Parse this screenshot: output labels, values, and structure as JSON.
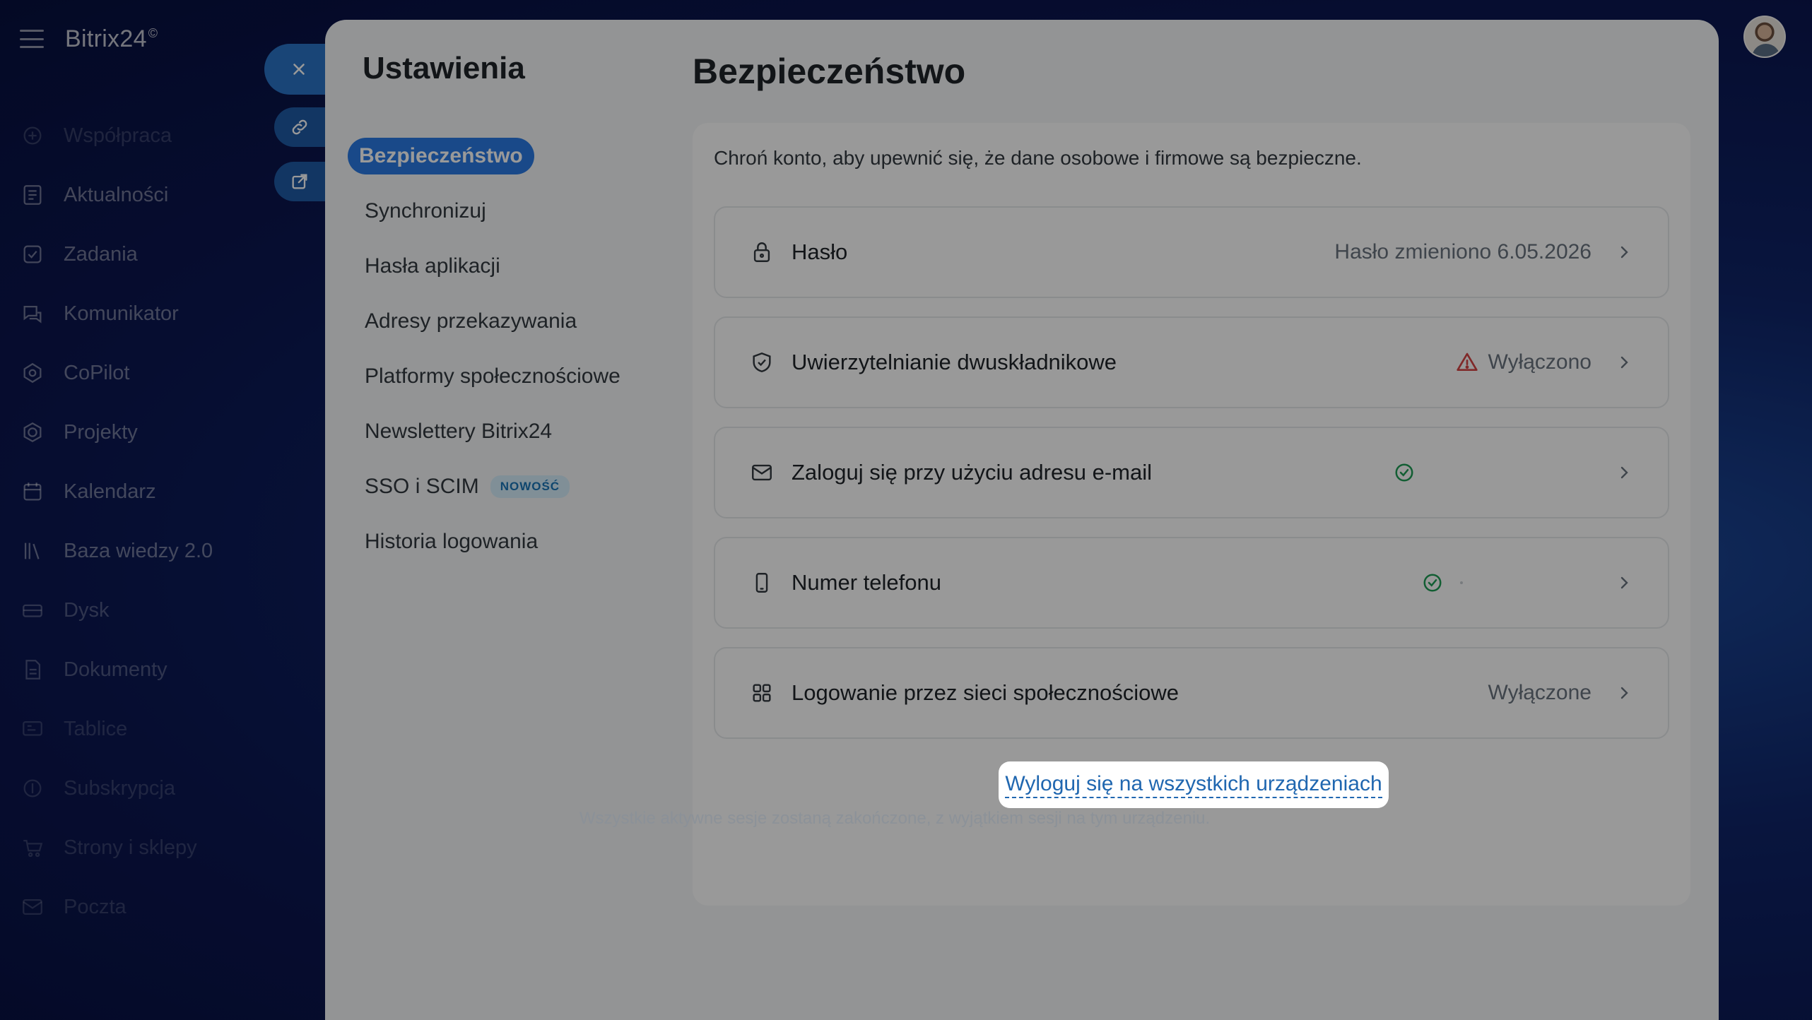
{
  "app": {
    "logo": "Bitrix24",
    "logo_mark": "©"
  },
  "nav": [
    {
      "label": "Współpraca",
      "icon": "collaboration-icon"
    },
    {
      "label": "Aktualności",
      "icon": "news-icon"
    },
    {
      "label": "Zadania",
      "icon": "tasks-icon"
    },
    {
      "label": "Komunikator",
      "icon": "messenger-icon"
    },
    {
      "label": "CoPilot",
      "icon": "copilot-icon"
    },
    {
      "label": "Projekty",
      "icon": "projects-icon"
    },
    {
      "label": "Kalendarz",
      "icon": "calendar-icon"
    },
    {
      "label": "Baza wiedzy 2.0",
      "icon": "knowledge-base-icon"
    },
    {
      "label": "Dysk",
      "icon": "drive-icon"
    },
    {
      "label": "Dokumenty",
      "icon": "documents-icon"
    },
    {
      "label": "Tablice",
      "icon": "boards-icon"
    },
    {
      "label": "Subskrypcja",
      "icon": "subscription-icon"
    },
    {
      "label": "Strony i sklepy",
      "icon": "shop-icon"
    },
    {
      "label": "Poczta",
      "icon": "mail-icon"
    }
  ],
  "settings": {
    "title": "Ustawienia",
    "menu": [
      {
        "label": "Bezpieczeństwo",
        "active": true
      },
      {
        "label": "Synchronizuj"
      },
      {
        "label": "Hasła aplikacji"
      },
      {
        "label": "Adresy przekazywania"
      },
      {
        "label": "Platformy społecznościowe"
      },
      {
        "label": "Newslettery Bitrix24"
      },
      {
        "label": "SSO i SCIM",
        "badge": "NOWOŚĆ"
      },
      {
        "label": "Historia logowania"
      }
    ]
  },
  "security": {
    "title": "Bezpieczeństwo",
    "intro": "Chroń konto, aby upewnić się, że dane osobowe i firmowe są bezpieczne.",
    "rows": [
      {
        "label": "Hasło",
        "status": "Hasło zmieniono 6.05.2026",
        "icon": "lock-icon"
      },
      {
        "label": "Uwierzytelnianie dwuskładnikowe",
        "status": "Wyłączono",
        "icon": "shield-icon"
      },
      {
        "label": "Zaloguj się przy użyciu adresu e-mail",
        "status": "",
        "icon": "mail-icon"
      },
      {
        "label": "Numer telefonu",
        "status": "",
        "icon": "phone-icon"
      },
      {
        "label": "Logowanie przez sieci społecznościowe",
        "status": "Wyłączone",
        "icon": "grid-icon"
      }
    ],
    "logout_all": "Wyloguj się na wszystkich urządzeniach",
    "logout_note": "Wszystkie aktywne sesje zostaną zakończone, z wyjątkiem sesji na tym urządzeniu."
  },
  "colors": {
    "accent": "#2a7ae4",
    "warning": "#d64545",
    "success": "#1f9d55",
    "link": "#2067b0"
  }
}
